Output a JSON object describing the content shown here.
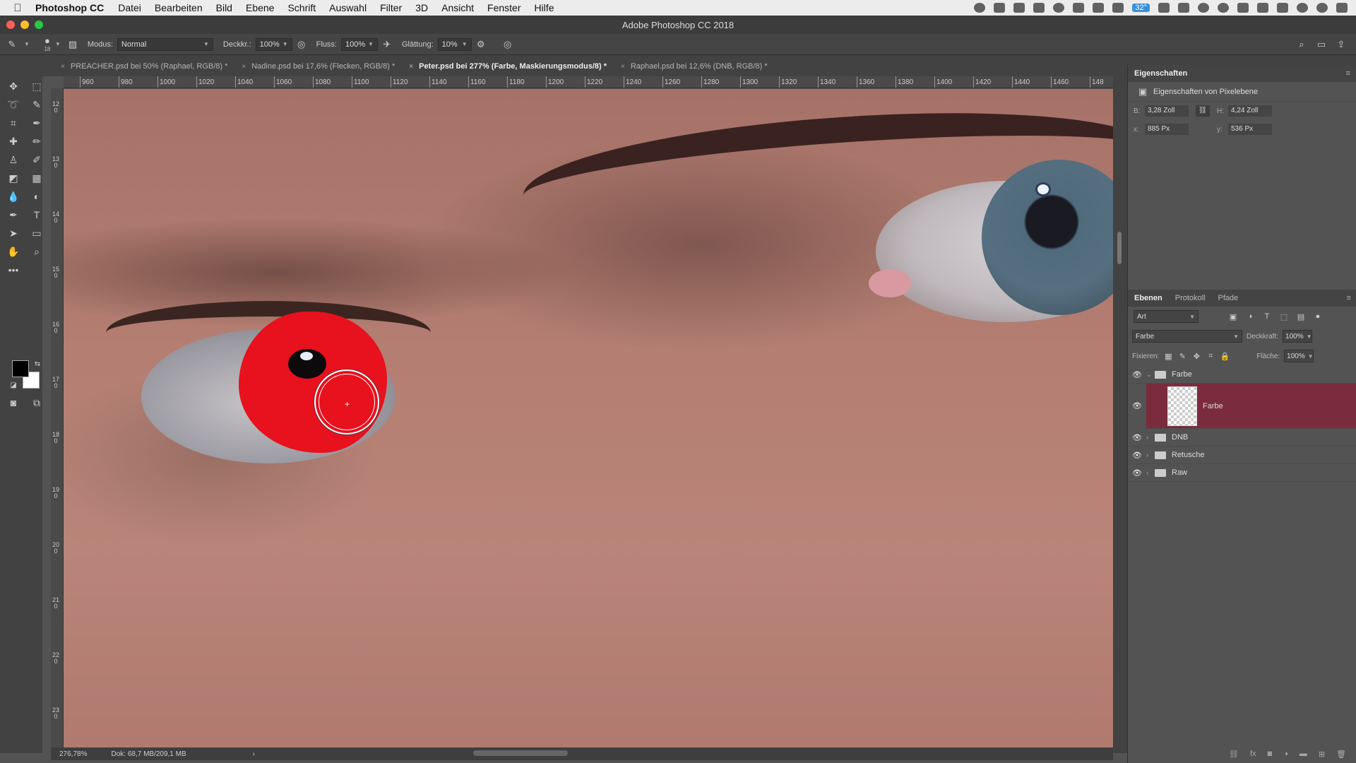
{
  "menubar": {
    "apple": "",
    "app_name": "Photoshop CC",
    "items": [
      "Datei",
      "Bearbeiten",
      "Bild",
      "Ebene",
      "Schrift",
      "Auswahl",
      "Filter",
      "3D",
      "Ansicht",
      "Fenster",
      "Hilfe"
    ],
    "temperature": "32°"
  },
  "window": {
    "title": "Adobe Photoshop CC 2018"
  },
  "options": {
    "brush_size": "18",
    "mode_label": "Modus:",
    "mode_value": "Normal",
    "opacity_label": "Deckkr.:",
    "opacity_value": "100%",
    "flow_label": "Fluss:",
    "flow_value": "100%",
    "smoothing_label": "Glättung:",
    "smoothing_value": "10%"
  },
  "tabs": [
    {
      "label": "PREACHER.psd bei 50% (Raphael, RGB/8) *"
    },
    {
      "label": "Nadine.psd bei 17,6% (Flecken, RGB/8) *"
    },
    {
      "label": "Peter.psd bei 277% (Farbe, Maskierungsmodus/8) *"
    },
    {
      "label": "Raphael.psd bei 12,6% (DNB, RGB/8) *"
    }
  ],
  "ruler": {
    "h_ticks": [
      "960",
      "980",
      "1000",
      "1020",
      "1040",
      "1060",
      "1080",
      "1100",
      "1120",
      "1140",
      "1160",
      "1180",
      "1200",
      "1220",
      "1240",
      "1260",
      "1280",
      "1300",
      "1320",
      "1340",
      "1360",
      "1380",
      "1400",
      "1420",
      "1440",
      "1460",
      "148"
    ],
    "v_ticks": [
      "120",
      "130",
      "140",
      "150",
      "160",
      "170",
      "180",
      "190",
      "200",
      "210",
      "220",
      "230"
    ]
  },
  "status": {
    "zoom": "276,78%",
    "doc": "Dok: 68,7 MB/209,1 MB",
    "arrow": "›"
  },
  "properties": {
    "tab": "Eigenschaften",
    "subtitle": "Eigenschaften von Pixelebene",
    "w_label": "B:",
    "w_value": "3,28 Zoll",
    "h_label": "H:",
    "h_value": "4,24 Zoll",
    "x_label": "x:",
    "x_value": "885 Px",
    "y_label": "y:",
    "y_value": "536 Px"
  },
  "layers_panel": {
    "tabs": [
      "Ebenen",
      "Protokoll",
      "Pfade"
    ],
    "kind_filter": "Art",
    "blend_mode": "Farbe",
    "opacity_label": "Deckkraft:",
    "opacity_value": "100%",
    "lock_label": "Fixieren:",
    "fill_label": "Fläche:",
    "fill_value": "100%",
    "layers": [
      {
        "name": "Farbe",
        "type": "group",
        "expanded": true
      },
      {
        "name": "Farbe",
        "type": "layer",
        "selected": true
      },
      {
        "name": "DNB",
        "type": "group"
      },
      {
        "name": "Retusche",
        "type": "group"
      },
      {
        "name": "Raw",
        "type": "group"
      }
    ]
  },
  "colors": {
    "accent_selection": "#7a2c3d",
    "mask_red": "#e8111e"
  }
}
